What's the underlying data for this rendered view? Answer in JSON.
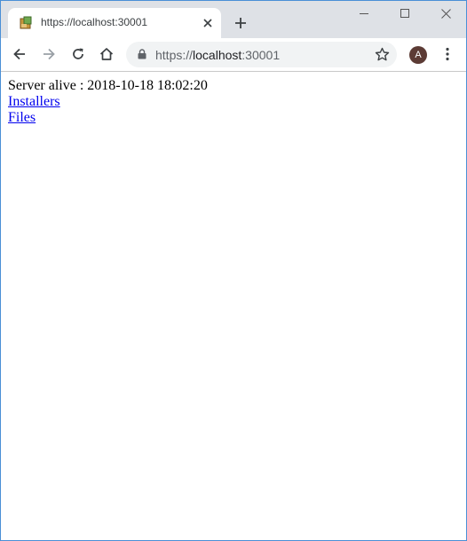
{
  "tab": {
    "title": "https://localhost:30001"
  },
  "toolbar": {
    "url_scheme": "https://",
    "url_host": "localhost",
    "url_port": ":30001",
    "avatar_letter": "A"
  },
  "page": {
    "status_label": "Server alive : ",
    "status_time": "2018-10-18 18:02:20",
    "links": [
      {
        "label": "Installers"
      },
      {
        "label": "Files"
      }
    ]
  },
  "colors": {
    "link": "#0000ee",
    "avatar": "#5c3b35",
    "tabstrip": "#dee1e6"
  }
}
